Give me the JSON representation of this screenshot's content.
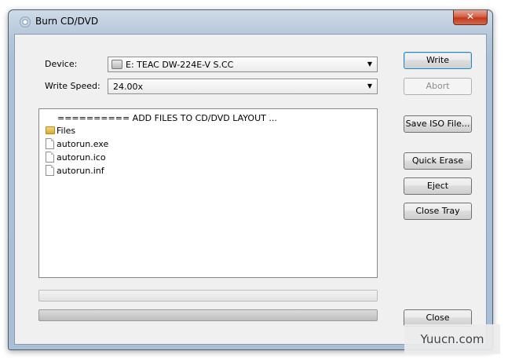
{
  "window": {
    "title": "Burn CD/DVD",
    "close_glyph": "✕"
  },
  "device": {
    "label": "Device:",
    "value": "E: TEAC DW-224E-V S.CC"
  },
  "write_speed": {
    "label": "Write Speed:",
    "value": "24.00x"
  },
  "files": {
    "header": "========== ADD FILES TO CD/DVD LAYOUT ...",
    "items": [
      {
        "name": "Files",
        "icon": "folder-icon"
      },
      {
        "name": "autorun.exe",
        "icon": "file-icon"
      },
      {
        "name": "autorun.ico",
        "icon": "file-icon"
      },
      {
        "name": "autorun.inf",
        "icon": "file-icon"
      }
    ]
  },
  "buttons": {
    "write": "Write",
    "abort": "Abort",
    "save_iso": "Save ISO File...",
    "quick_erase": "Quick Erase",
    "eject": "Eject",
    "close_tray": "Close Tray",
    "close": "Close"
  },
  "progress": {
    "bar1": 0,
    "bar2": 0
  },
  "watermark": "Yuucn.com",
  "colors": {
    "accent_border": "#3c7fb1",
    "close_red": "#c0391f"
  }
}
